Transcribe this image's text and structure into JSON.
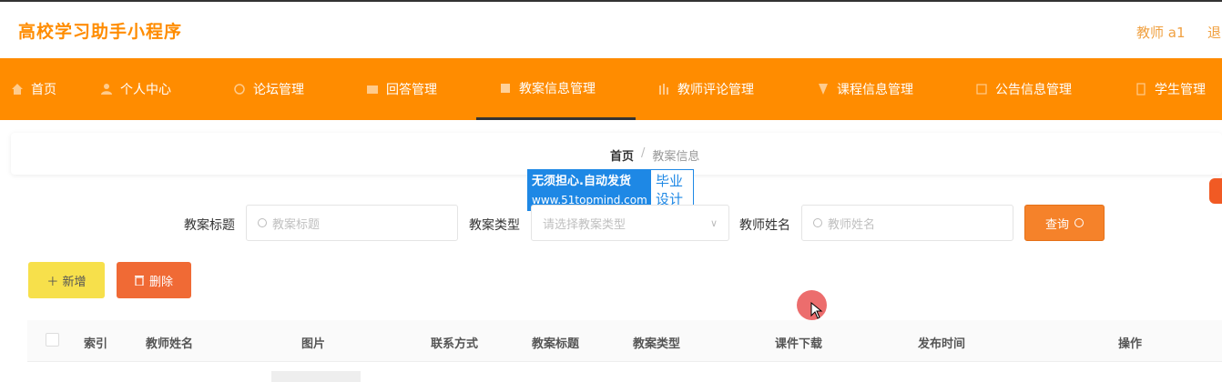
{
  "header": {
    "brand": "高校学习助手小程序",
    "user": "教师 a1",
    "logout": "退"
  },
  "nav": {
    "items": [
      {
        "label": "首页",
        "icon": "home-icon"
      },
      {
        "label": "个人中心",
        "icon": "user-icon"
      },
      {
        "label": "论坛管理",
        "icon": "forum-icon"
      },
      {
        "label": "回答管理",
        "icon": "answer-icon"
      },
      {
        "label": "教案信息管理",
        "icon": "lesson-plan-icon",
        "active": true
      },
      {
        "label": "教师评论管理",
        "icon": "comment-icon"
      },
      {
        "label": "课程信息管理",
        "icon": "course-icon"
      },
      {
        "label": "公告信息管理",
        "icon": "notice-icon"
      },
      {
        "label": "学生管理",
        "icon": "student-icon"
      }
    ]
  },
  "breadcrumb": {
    "home": "首页",
    "sep": "/",
    "current": "教案信息"
  },
  "watermark": {
    "line1": "无须担心.自动发货",
    "line2": "www.51topmind.com",
    "right1": "毕业",
    "right2": "设计"
  },
  "search": {
    "title_label": "教案标题",
    "title_placeholder": "教案标题",
    "type_label": "教案类型",
    "type_placeholder": "请选择教案类型",
    "teacher_label": "教师姓名",
    "teacher_placeholder": "教师姓名",
    "query_label": "查询"
  },
  "actions": {
    "add_label": "＋ 新增",
    "delete_label": "删除"
  },
  "table": {
    "columns": [
      "索引",
      "教师姓名",
      "图片",
      "联系方式",
      "教案标题",
      "教案类型",
      "课件下载",
      "发布时间",
      "操作"
    ]
  },
  "colors": {
    "accent": "#ff8c00",
    "add": "#f7e04b",
    "delete": "#f06a35",
    "query": "#f5822a"
  }
}
